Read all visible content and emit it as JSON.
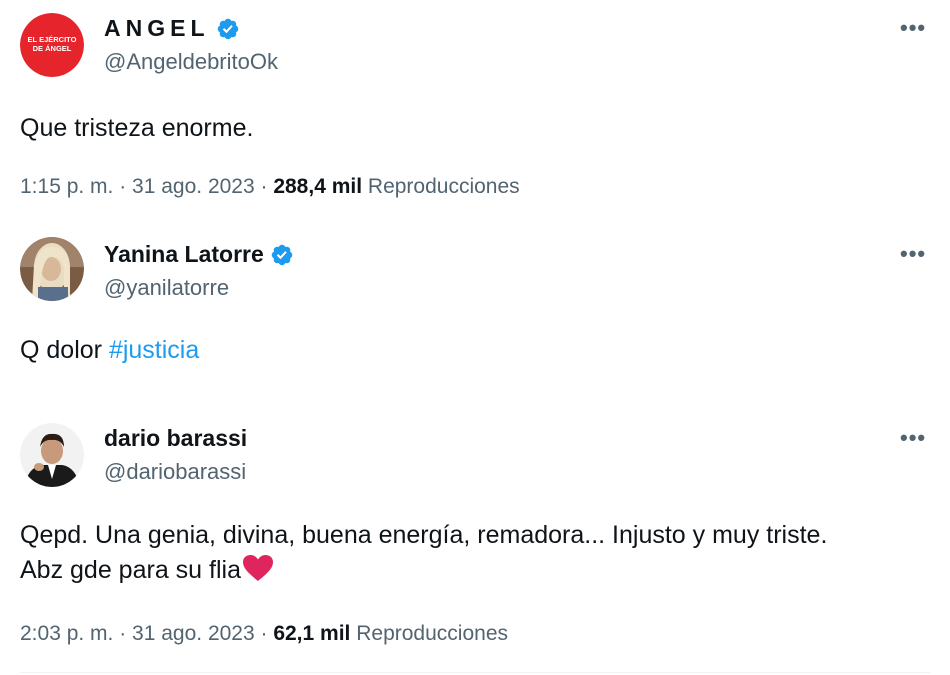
{
  "tweets": [
    {
      "display_name": "ANGEL",
      "handle": "@AngeldebritoOk",
      "avatar_text": "EL EJÉRCITO DE ÁNGEL",
      "avatar_color": "#e5242b",
      "verified": true,
      "more_label": "•••",
      "text": "Que tristeza enorme.",
      "time": "1:15 p. m. · 31 ago. 2023 · ",
      "views_count": "288,4 mil",
      "views_label": "Reproducciones"
    },
    {
      "display_name": "Yanina Latorre",
      "handle": "@yanilatorre",
      "avatar_icon": "profile-photo",
      "verified": true,
      "more_label": "•••",
      "text_prefix": "Q dolor ",
      "hashtag": "#justicia"
    },
    {
      "display_name": "dario barassi",
      "handle": "@dariobarassi",
      "avatar_icon": "profile-photo",
      "verified": false,
      "more_label": "•••",
      "text_line1": "Qepd. Una genia, divina, buena energía, remadora... Injusto y muy triste.",
      "text_line2": "Abz gde para su flia",
      "emoji": "red-heart-icon",
      "time": "2:03 p. m. · 31 ago. 2023 · ",
      "views_count": "62,1 mil",
      "views_label": "Reproducciones"
    }
  ],
  "colors": {
    "text": "#0f1419",
    "secondary": "#536471",
    "link": "#1d9bf0",
    "verified": "#1d9bf0",
    "heart": "#e0245e"
  }
}
